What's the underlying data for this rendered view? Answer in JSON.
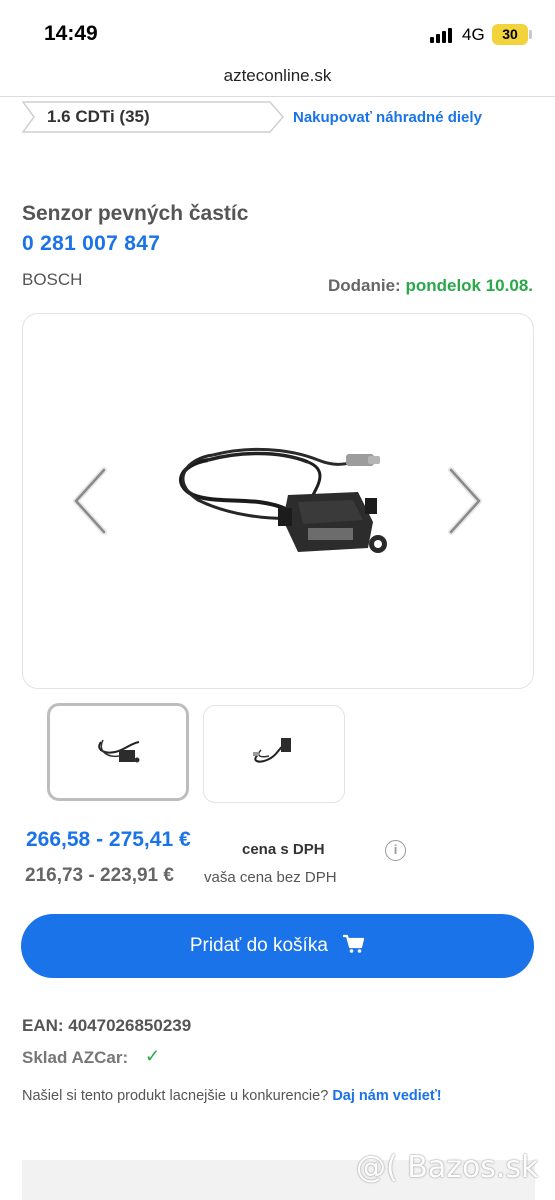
{
  "status_bar": {
    "time": "14:49",
    "network": "4G",
    "battery": "30"
  },
  "browser": {
    "url": "azteconline.sk"
  },
  "breadcrumb": {
    "label": "1.6 CDTi (35)",
    "link": "Nakupovať náhradné diely"
  },
  "product": {
    "title": "Senzor pevných častíc",
    "part_number": "0 281 007 847",
    "brand": "BOSCH",
    "delivery_label": "Dodanie:",
    "delivery_date": "pondelok 10.08."
  },
  "gallery": {
    "prev_icon": "chevron-left-icon",
    "next_icon": "chevron-right-icon",
    "thumbnail_count": 2,
    "selected_thumbnail": 1
  },
  "pricing": {
    "price_with_vat": "266,58 - 275,41 €",
    "price_with_vat_label": "cena s DPH",
    "price_without_vat": "216,73 - 223,91 €",
    "price_without_vat_label": "vaša cena bez DPH",
    "info_icon": "i"
  },
  "actions": {
    "add_to_cart": "Pridať do košíka"
  },
  "details": {
    "ean": "EAN: 4047026850239",
    "stock_label": "Sklad AZCar:",
    "stock_icon": "✓",
    "compare_text": "Našiel si tento produkt lacnejšie u konkurencie?",
    "compare_link": "Daj nám vedieť!"
  },
  "watermark": "@( Bazos.sk",
  "colors": {
    "accent": "#1a73e8",
    "delivery_green": "#2aa84a",
    "battery": "#f2d33c"
  }
}
